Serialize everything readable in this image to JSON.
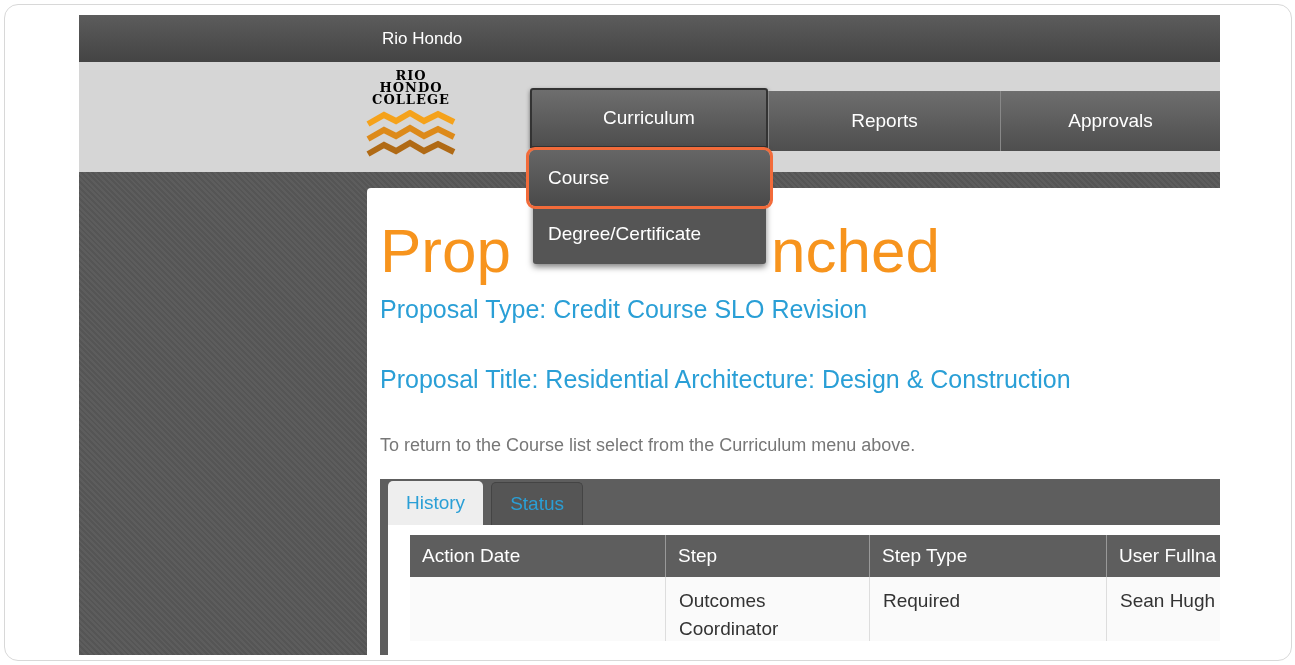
{
  "top_bar": {
    "title": "Rio Hondo"
  },
  "logo": {
    "lines": [
      "RIO",
      "HONDO",
      "COLLEGE"
    ]
  },
  "nav": [
    {
      "label": "Curriculum",
      "selected": true,
      "expanded": true
    },
    {
      "label": "Reports",
      "selected": false,
      "expanded": false
    },
    {
      "label": "Approvals",
      "selected": false,
      "expanded": false
    }
  ],
  "dropdown": [
    {
      "label": "Course",
      "highlighted": true
    },
    {
      "label": "Degree/Certificate",
      "highlighted": false
    }
  ],
  "page": {
    "heading_parts": [
      "Prop",
      "nched"
    ],
    "proposal_type": "Proposal Type: Credit Course SLO Revision",
    "proposal_title": "Proposal Title: Residential Architecture: Design & Construction",
    "note": "To return to the Course list select from the Curriculum menu above."
  },
  "tabs": [
    {
      "label": "History",
      "selected": true
    },
    {
      "label": "Status",
      "selected": false
    }
  ],
  "table": {
    "columns": [
      "Action Date",
      "Step",
      "Step Type",
      "User Fullna"
    ],
    "rows": [
      [
        "",
        "Outcomes Coordinator",
        "Required",
        "Sean Hugh"
      ]
    ]
  }
}
